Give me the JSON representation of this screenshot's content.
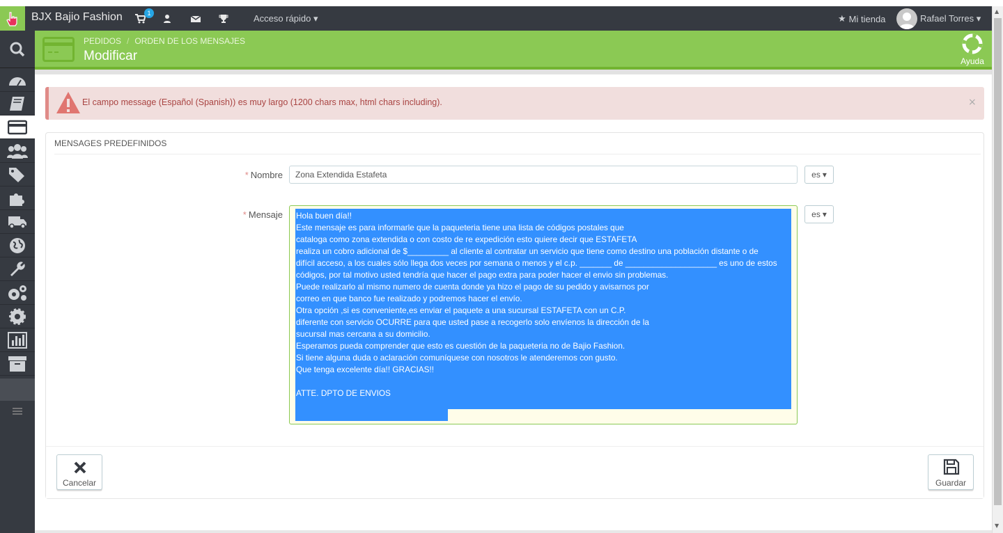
{
  "topbar": {
    "shop_name": "BJX Bajio Fashion",
    "cart_badge": "1",
    "quick_access": "Acceso rápido",
    "my_store": "Mi tienda",
    "user_name": "Rafael Torres"
  },
  "header": {
    "breadcrumb": [
      "PEDIDOS",
      "ORDEN DE LOS MENSAJES"
    ],
    "title": "Modificar",
    "help_label": "Ayuda"
  },
  "alert": {
    "message": "El campo message (Español (Spanish)) es muy largo (1200 chars max, html chars including).",
    "close": "×"
  },
  "panel": {
    "heading": "MENSAGES PREDEFINIDOS",
    "name_label": "Nombre",
    "name_value": "Zona Extendida Estafeta",
    "lang_name": "es",
    "message_label": "Mensaje",
    "lang_message": "es",
    "required_mark": "*",
    "message_value": "Hola buen día!!\nEste mensaje es para informarle que la paqueteria tiene una lista de códigos postales que\ncataloga como zona extendida o con costo de re expedición esto quiere decir que ESTAFETA\nrealiza un cobro adicional de $_________ al cliente al contratar un servicio que tiene como destino una población distante o de\ndifícil acceso, a los cuales sólo llega dos veces por semana o menos y el c.p. _______ de ____________________ es uno de estos\ncódigos, por tal motivo usted tendría que hacer el pago extra para poder hacer el envio sin problemas.\nPuede realizarlo al mismo numero de cuenta donde ya hizo el pago de su pedido y avisarnos por\ncorreo en que banco fue realizado y podremos hacer el envío.\nOtra opción ,si es conveniente,es enviar el paquete a una sucursal ESTAFETA con un C.P.\ndiferente con servicio OCURRE para que usted pase a recogerlo solo envíenos la dirección de la\nsucursal mas cercana a su domicilio.\nEsperamos pueda comprender que esto es cuestión de la paqueteria no de Bajio Fashion.\nSi tiene alguna duda o aclaración comuníquese con nosotros le atenderemos con gusto.\nQue tenga excelente día!! GRACIAS!!\n\nATTE. DPTO DE ENVIOS",
    "cancel_label": "Cancelar",
    "save_label": "Guardar"
  },
  "colors": {
    "accent_green": "#8bc954",
    "topbar_dark": "#363a41",
    "alert_bg": "#f1dedd",
    "selection_blue": "#3390ff",
    "badge_blue": "#26a5e4"
  },
  "icons": [
    "pointer-hand-icon",
    "cart-icon",
    "user-icon",
    "envelope-icon",
    "trophy-icon",
    "star-icon",
    "search-icon",
    "dashboard-icon",
    "book-icon",
    "credit-card-icon",
    "users-icon",
    "tags-icon",
    "puzzle-icon",
    "truck-icon",
    "globe-icon",
    "wrench-icon",
    "cogs-icon",
    "gear-icon",
    "chart-icon",
    "archive-icon",
    "lifebuoy-icon",
    "warning-icon",
    "close-icon",
    "save-icon",
    "menu-icon"
  ]
}
